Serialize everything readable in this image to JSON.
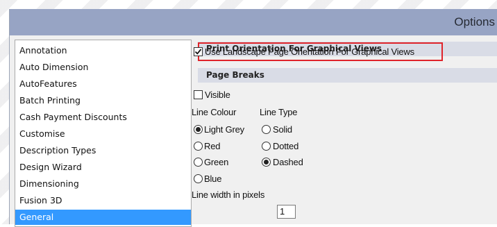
{
  "window": {
    "title": "Options"
  },
  "categories": [
    {
      "label": "Annotation",
      "selected": false
    },
    {
      "label": "Auto Dimension",
      "selected": false
    },
    {
      "label": "AutoFeatures",
      "selected": false
    },
    {
      "label": "Batch Printing",
      "selected": false
    },
    {
      "label": "Cash Payment Discounts",
      "selected": false
    },
    {
      "label": "Customise",
      "selected": false
    },
    {
      "label": "Description Types",
      "selected": false
    },
    {
      "label": "Design Wizard",
      "selected": false
    },
    {
      "label": "Dimensioning",
      "selected": false
    },
    {
      "label": "Fusion 3D",
      "selected": false
    },
    {
      "label": "General",
      "selected": true
    }
  ],
  "print_orientation": {
    "header": "Print Orientation For Graphical Views",
    "landscape_label": "Use Landscape Page Orientation For Graphical Views",
    "landscape_checked": true
  },
  "page_breaks": {
    "header": "Page Breaks",
    "visible_label": "Visible",
    "visible_checked": false,
    "line_colour_label": "Line Colour",
    "line_type_label": "Line Type",
    "colours": [
      "Light Grey",
      "Red",
      "Green",
      "Blue"
    ],
    "selected_colour": "Light Grey",
    "types": [
      "Solid",
      "Dotted",
      "Dashed"
    ],
    "selected_type": "Dashed",
    "line_width_label": "Line width in pixels",
    "line_width_value": "1"
  },
  "colors": {
    "titlebar": "#97a4c4",
    "selection": "#3399ff",
    "section_header": "#d9dce6",
    "highlight_border": "#e0242a"
  }
}
